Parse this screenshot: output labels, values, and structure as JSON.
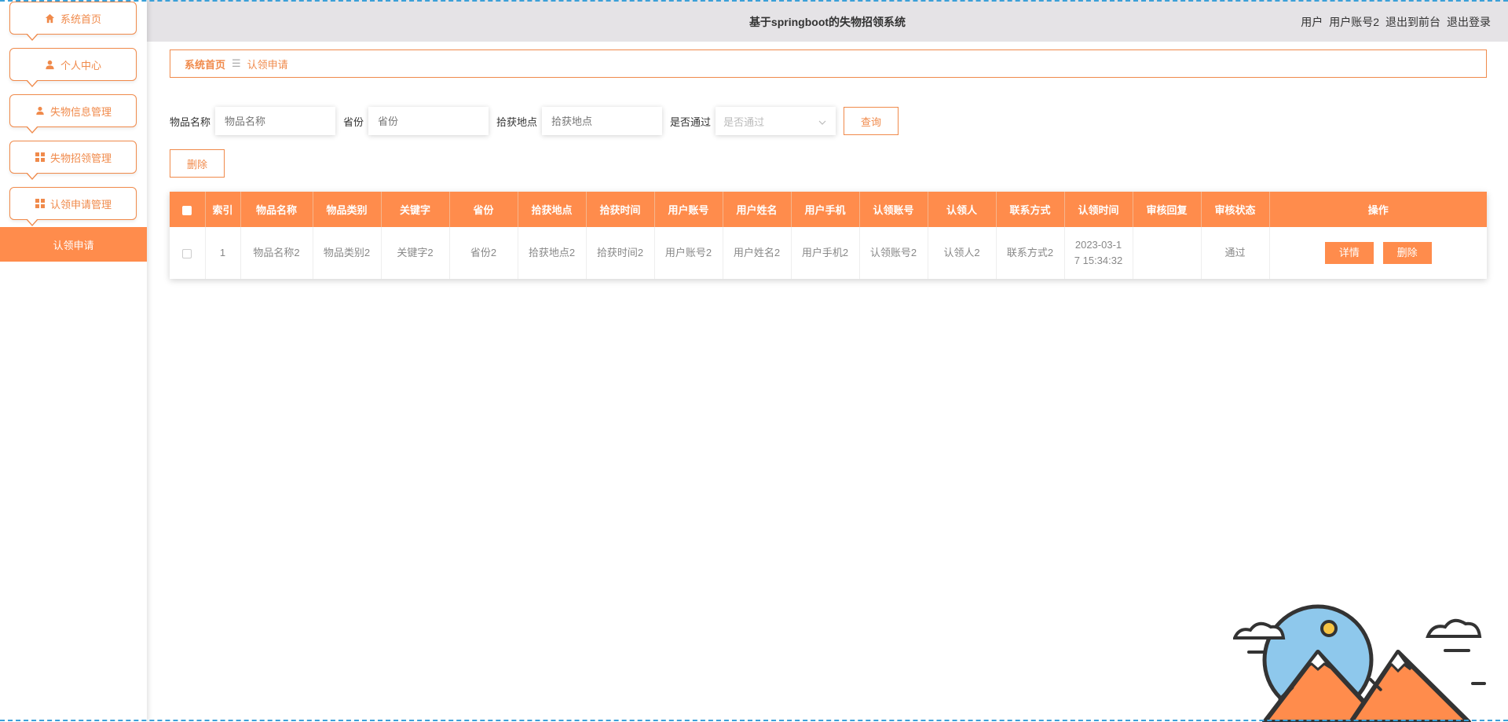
{
  "header": {
    "title": "基于springboot的失物招领系统",
    "user_role": "用户",
    "user_name": "用户账号2",
    "back_front": "退出到前台",
    "logout": "退出登录"
  },
  "sidebar": {
    "items": [
      {
        "label": "系统首页",
        "icon": "home-icon"
      },
      {
        "label": "个人中心",
        "icon": "user-icon"
      },
      {
        "label": "失物信息管理",
        "icon": "user-icon"
      },
      {
        "label": "失物招领管理",
        "icon": "grid-icon"
      },
      {
        "label": "认领申请管理",
        "icon": "grid-icon"
      }
    ],
    "active_sub": "认领申请"
  },
  "breadcrumb": {
    "home": "系统首页",
    "sep": "☰",
    "current": "认领申请"
  },
  "search": {
    "name_label": "物品名称",
    "name_placeholder": "物品名称",
    "province_label": "省份",
    "province_placeholder": "省份",
    "place_label": "拾获地点",
    "place_placeholder": "拾获地点",
    "pass_label": "是否通过",
    "pass_placeholder": "是否通过",
    "query_button": "查询",
    "delete_button": "删除"
  },
  "table": {
    "headers": [
      "索引",
      "物品名称",
      "物品类别",
      "关键字",
      "省份",
      "拾获地点",
      "拾获时间",
      "用户账号",
      "用户姓名",
      "用户手机",
      "认领账号",
      "认领人",
      "联系方式",
      "认领时间",
      "审核回复",
      "审核状态",
      "操作"
    ],
    "rows": [
      {
        "index": "1",
        "name": "物品名称2",
        "category": "物品类别2",
        "keyword": "关键字2",
        "province": "省份2",
        "place": "拾获地点2",
        "found_time": "拾获时间2",
        "user_account": "用户账号2",
        "user_name": "用户姓名2",
        "user_phone": "用户手机2",
        "claim_account": "认领账号2",
        "claimer": "认领人2",
        "contact": "联系方式2",
        "claim_time_1": "2023-03-1",
        "claim_time_2": "7 15:34:32",
        "review_reply": "",
        "review_status": "通过",
        "detail_button": "详情",
        "delete_button": "删除"
      }
    ]
  },
  "colors": {
    "accent": "#ff8c4c",
    "border": "#f08a4b",
    "header_bg": "#e5e3e6"
  }
}
